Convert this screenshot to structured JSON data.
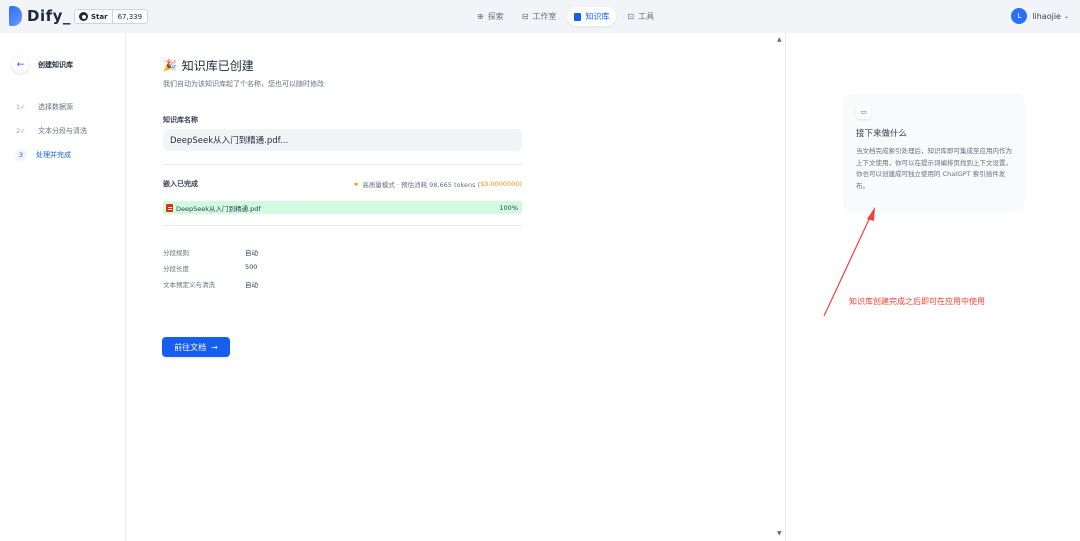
{
  "topbar": {
    "logo_text": "Dify_",
    "star_label": "Star",
    "star_count": "67,339",
    "nav": [
      {
        "label": "探索",
        "icon": "compass-icon",
        "active": false
      },
      {
        "label": "工作室",
        "icon": "terminal-icon",
        "active": false
      },
      {
        "label": "知识库",
        "icon": "book-icon",
        "active": true
      },
      {
        "label": "工具",
        "icon": "briefcase-icon",
        "active": false
      }
    ],
    "user": {
      "initial": "L",
      "name": "lihaojie"
    }
  },
  "sidebar": {
    "back_label": "创建知识库",
    "steps": [
      {
        "num": "1✓",
        "label": "选择数据源"
      },
      {
        "num": "2✓",
        "label": "文本分段与清洗"
      },
      {
        "num": "3",
        "label": "处理并完成"
      }
    ]
  },
  "main": {
    "title": "知识库已创建",
    "subtitle": "我们自动为该知识库起了个名称，您也可以随时修改",
    "name_label": "知识库名称",
    "name_value": "DeepSeek从入门到精通.pdf...",
    "embed_label": "嵌入已完成",
    "embed_mode": "高质量模式 · 预估消耗 98,665 tokens (",
    "embed_cost": "$0.0000000",
    "embed_close": ")",
    "file_name": "DeepSeek从入门到精通.pdf",
    "file_progress": "100%",
    "file_progress_value": 1.0,
    "settings": [
      {
        "key": "分段规则",
        "value": "自动"
      },
      {
        "key": "分段长度",
        "value": "500"
      },
      {
        "key": "文本预定义与清洗",
        "value": "自动"
      }
    ],
    "goto_button": "前往文档"
  },
  "right": {
    "tip_title": "接下来做什么",
    "tip_body": "当文档完成索引处理后，知识库即可集成至应用内作为上下文使用，你可以在提示词编排页找到上下文设置。你也可以创建成可独立使用的 ChatGPT 索引插件发布。",
    "annotation": "知识库创建完成之后即可在应用中使用"
  },
  "colors": {
    "accent": "#155eef",
    "success_bg": "#d1fadf",
    "warning": "#f79009",
    "annotation": "#f04438"
  }
}
